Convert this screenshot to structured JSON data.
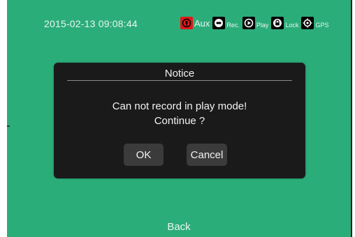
{
  "status": {
    "datetime": "2015-02-13 09:08:44",
    "items": [
      {
        "icon": "aux-icon",
        "label": "Aux",
        "color": "#e01818"
      },
      {
        "icon": "record-icon",
        "label": "Rec."
      },
      {
        "icon": "play-icon",
        "label": "Play"
      },
      {
        "icon": "lock-icon",
        "label": "Lock"
      },
      {
        "icon": "gps-icon",
        "label": "GPS"
      }
    ]
  },
  "dialog": {
    "title": "Notice",
    "message_line1": "Can not record in play mode!",
    "message_line2": "Continue ?",
    "ok_label": "OK",
    "cancel_label": "Cancel"
  },
  "footer": {
    "back_label": "Back"
  },
  "colors": {
    "background": "#2bad7a",
    "dialog": "#1a1a1a",
    "button": "#3b3b3b"
  }
}
